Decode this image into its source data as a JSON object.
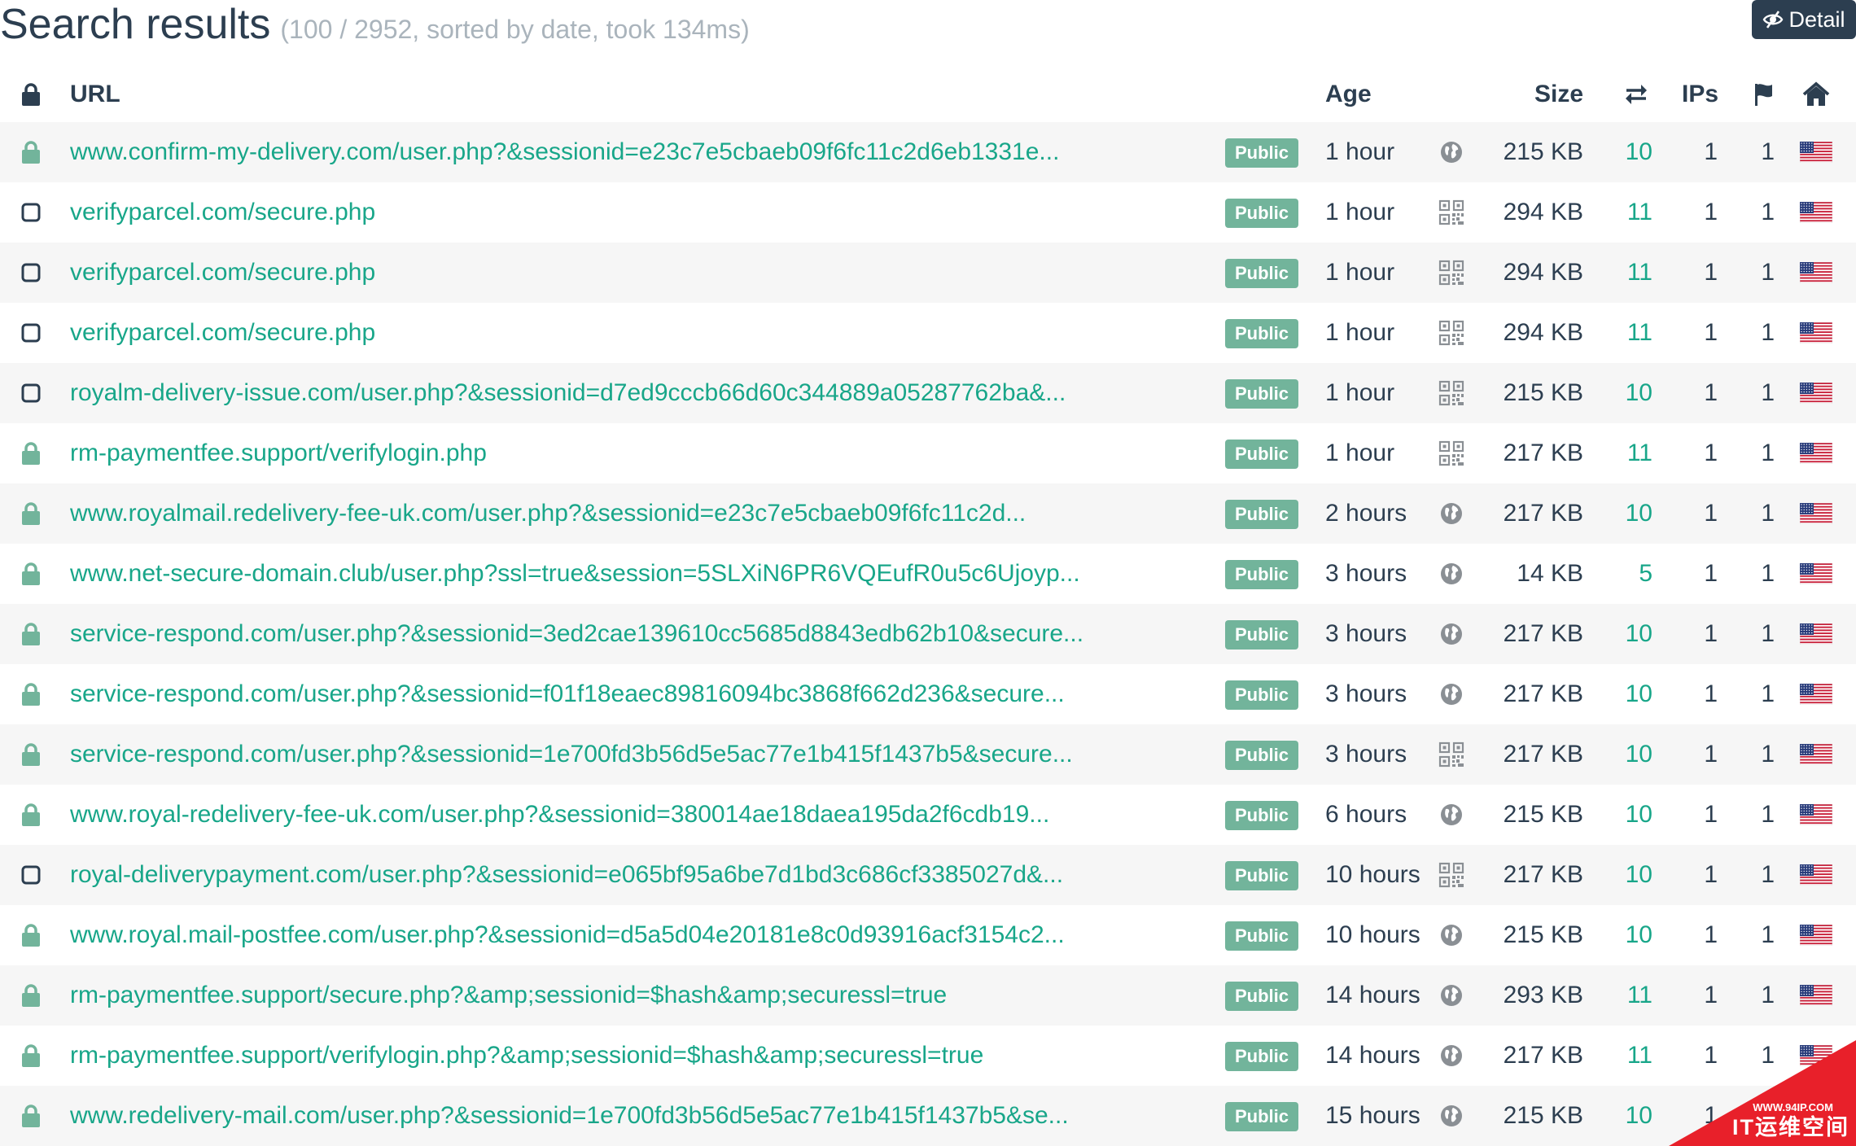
{
  "header": {
    "title": "Search results",
    "meta": "(100 / 2952, sorted by date, took 134ms)",
    "detail_label": "Detail"
  },
  "columns": {
    "url": "URL",
    "age": "Age",
    "size": "Size",
    "ips": "IPs"
  },
  "colors": {
    "link": "#18a689",
    "badge": "#72b49b",
    "dark": "#2c3e50",
    "muted": "#aab4bc"
  },
  "rows": [
    {
      "secure": true,
      "url": "www.confirm-my-delivery.com/user.php?&sessionid=e23c7e5cbaeb09f6fc11c2d6eb1331e...",
      "visibility": "Public",
      "age": "1 hour",
      "type": "globe",
      "size": "215 KB",
      "requests": "10",
      "ips": "1",
      "countries": "1",
      "flag": "us-flag"
    },
    {
      "secure": false,
      "url": "verifyparcel.com/secure.php",
      "visibility": "Public",
      "age": "1 hour",
      "type": "qr",
      "size": "294 KB",
      "requests": "11",
      "ips": "1",
      "countries": "1",
      "flag": "us-flag"
    },
    {
      "secure": false,
      "url": "verifyparcel.com/secure.php",
      "visibility": "Public",
      "age": "1 hour",
      "type": "qr",
      "size": "294 KB",
      "requests": "11",
      "ips": "1",
      "countries": "1",
      "flag": "us-flag"
    },
    {
      "secure": false,
      "url": "verifyparcel.com/secure.php",
      "visibility": "Public",
      "age": "1 hour",
      "type": "qr",
      "size": "294 KB",
      "requests": "11",
      "ips": "1",
      "countries": "1",
      "flag": "us-flag"
    },
    {
      "secure": false,
      "url": "royalm-delivery-issue.com/user.php?&sessionid=d7ed9cccb66d60c344889a05287762ba&...",
      "visibility": "Public",
      "age": "1 hour",
      "type": "qr",
      "size": "215 KB",
      "requests": "10",
      "ips": "1",
      "countries": "1",
      "flag": "us-flag"
    },
    {
      "secure": true,
      "url": "rm-paymentfee.support/verifylogin.php",
      "visibility": "Public",
      "age": "1 hour",
      "type": "qr",
      "size": "217 KB",
      "requests": "11",
      "ips": "1",
      "countries": "1",
      "flag": "us-flag"
    },
    {
      "secure": true,
      "url": "www.royalmail.redelivery-fee-uk.com/user.php?&sessionid=e23c7e5cbaeb09f6fc11c2d...",
      "visibility": "Public",
      "age": "2 hours",
      "type": "globe",
      "size": "217 KB",
      "requests": "10",
      "ips": "1",
      "countries": "1",
      "flag": "us-flag"
    },
    {
      "secure": true,
      "url": "www.net-secure-domain.club/user.php?ssl=true&session=5SLXiN6PR6VQEufR0u5c6Ujoyp...",
      "visibility": "Public",
      "age": "3 hours",
      "type": "globe",
      "size": "14 KB",
      "requests": "5",
      "ips": "1",
      "countries": "1",
      "flag": "us-flag"
    },
    {
      "secure": true,
      "url": "service-respond.com/user.php?&sessionid=3ed2cae139610cc5685d8843edb62b10&secure...",
      "visibility": "Public",
      "age": "3 hours",
      "type": "globe",
      "size": "217 KB",
      "requests": "10",
      "ips": "1",
      "countries": "1",
      "flag": "us-flag"
    },
    {
      "secure": true,
      "url": "service-respond.com/user.php?&sessionid=f01f18eaec89816094bc3868f662d236&secure...",
      "visibility": "Public",
      "age": "3 hours",
      "type": "globe",
      "size": "217 KB",
      "requests": "10",
      "ips": "1",
      "countries": "1",
      "flag": "us-flag"
    },
    {
      "secure": true,
      "url": "service-respond.com/user.php?&sessionid=1e700fd3b56d5e5ac77e1b415f1437b5&secure...",
      "visibility": "Public",
      "age": "3 hours",
      "type": "qr",
      "size": "217 KB",
      "requests": "10",
      "ips": "1",
      "countries": "1",
      "flag": "us-flag"
    },
    {
      "secure": true,
      "url": "www.royal-redelivery-fee-uk.com/user.php?&sessionid=380014ae18daea195da2f6cdb19...",
      "visibility": "Public",
      "age": "6 hours",
      "type": "globe",
      "size": "215 KB",
      "requests": "10",
      "ips": "1",
      "countries": "1",
      "flag": "us-flag"
    },
    {
      "secure": false,
      "url": "royal-deliverypayment.com/user.php?&sessionid=e065bf95a6be7d1bd3c686cf3385027d&...",
      "visibility": "Public",
      "age": "10 hours",
      "type": "qr",
      "size": "217 KB",
      "requests": "10",
      "ips": "1",
      "countries": "1",
      "flag": "us-flag"
    },
    {
      "secure": true,
      "url": "www.royal.mail-postfee.com/user.php?&sessionid=d5a5d04e20181e8c0d93916acf3154c2...",
      "visibility": "Public",
      "age": "10 hours",
      "type": "globe",
      "size": "215 KB",
      "requests": "10",
      "ips": "1",
      "countries": "1",
      "flag": "us-flag"
    },
    {
      "secure": true,
      "url": "rm-paymentfee.support/secure.php?&amp;sessionid=$hash&amp;securessl=true",
      "visibility": "Public",
      "age": "14 hours",
      "type": "globe",
      "size": "293 KB",
      "requests": "11",
      "ips": "1",
      "countries": "1",
      "flag": "us-flag"
    },
    {
      "secure": true,
      "url": "rm-paymentfee.support/verifylogin.php?&amp;sessionid=$hash&amp;securessl=true",
      "visibility": "Public",
      "age": "14 hours",
      "type": "globe",
      "size": "217 KB",
      "requests": "11",
      "ips": "1",
      "countries": "1",
      "flag": "us-flag"
    },
    {
      "secure": true,
      "url": "www.redelivery-mail.com/user.php?&sessionid=1e700fd3b56d5e5ac77e1b415f1437b5&se...",
      "visibility": "Public",
      "age": "15 hours",
      "type": "globe",
      "size": "215 KB",
      "requests": "10",
      "ips": "1",
      "countries": "1",
      "flag": "us-flag"
    }
  ],
  "watermark": {
    "line1": "WWW.94IP.COM",
    "line2": "IT运维空间"
  }
}
